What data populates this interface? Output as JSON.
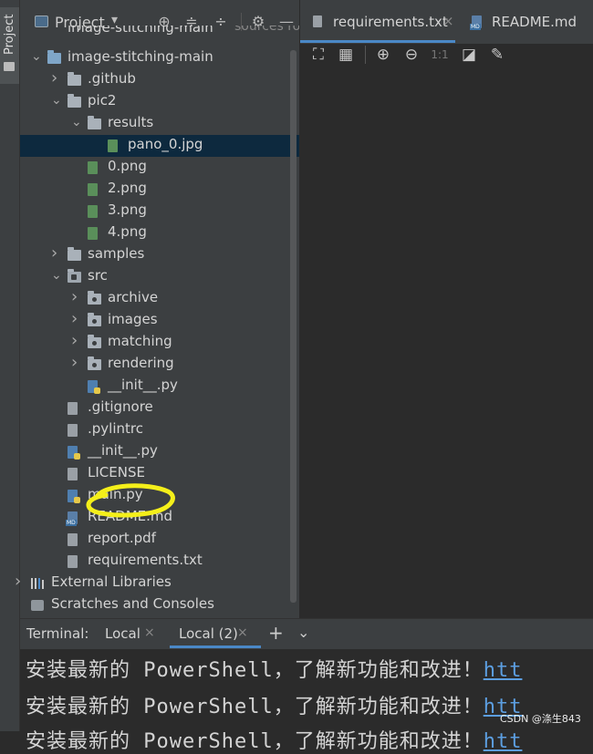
{
  "sidebar": {
    "tool_window_label": "Project"
  },
  "project_panel": {
    "view_label": "Project",
    "root_truncated": "image-stitching-main",
    "root_truncated_suffix": "sources root,",
    "tree": [
      {
        "label": "image-stitching-main",
        "type": "folder",
        "expanded": true
      },
      {
        "label": ".github",
        "type": "folder",
        "expanded": false
      },
      {
        "label": "pic2",
        "type": "folder",
        "expanded": true
      },
      {
        "label": "results",
        "type": "folder",
        "expanded": true
      },
      {
        "label": "pano_0.jpg",
        "type": "image",
        "selected": true
      },
      {
        "label": "0.png",
        "type": "image"
      },
      {
        "label": "2.png",
        "type": "image"
      },
      {
        "label": "3.png",
        "type": "image"
      },
      {
        "label": "4.png",
        "type": "image"
      },
      {
        "label": "samples",
        "type": "folder",
        "expanded": false
      },
      {
        "label": "src",
        "type": "folder",
        "expanded": true
      },
      {
        "label": "archive",
        "type": "package",
        "expanded": false
      },
      {
        "label": "images",
        "type": "package",
        "expanded": false
      },
      {
        "label": "matching",
        "type": "package",
        "expanded": false
      },
      {
        "label": "rendering",
        "type": "package",
        "expanded": false
      },
      {
        "label": "__init__.py",
        "type": "python"
      },
      {
        "label": ".gitignore",
        "type": "text"
      },
      {
        "label": ".pylintrc",
        "type": "text"
      },
      {
        "label": "__init__.py",
        "type": "python"
      },
      {
        "label": "LICENSE",
        "type": "text"
      },
      {
        "label": "main.py",
        "type": "python"
      },
      {
        "label": "README.md",
        "type": "markdown"
      },
      {
        "label": "report.pdf",
        "type": "pdf"
      },
      {
        "label": "requirements.txt",
        "type": "text"
      },
      {
        "label": "External Libraries",
        "type": "libraries",
        "expanded": false
      },
      {
        "label": "Scratches and Consoles",
        "type": "scratches"
      }
    ]
  },
  "editor": {
    "tabs": [
      {
        "label": "requirements.txt",
        "active": true
      },
      {
        "label": "README.md",
        "active": false
      }
    ],
    "image_tools": [
      "fit-icon",
      "grid-icon",
      "zoom-in-icon",
      "zoom-out-icon",
      "actual-size-icon",
      "background-icon",
      "color-picker-icon"
    ],
    "actual_size_label": "1:1"
  },
  "terminal": {
    "title": "Terminal:",
    "tabs": [
      {
        "label": "Local",
        "active": false
      },
      {
        "label": "Local (2)",
        "active": true
      }
    ],
    "lines": [
      {
        "text": "安装最新的 PowerShell，了解新功能和改进！",
        "link": "htt"
      },
      {
        "text": "安装最新的 PowerShell，了解新功能和改进！",
        "link": "htt"
      },
      {
        "text": "安装最新的 PowerShell，了解新功能和改进！",
        "link": "htt"
      }
    ]
  },
  "watermark": "CSDN @涤生843",
  "colors": {
    "selection": "#0d293e",
    "accent": "#4a88c7",
    "annotation": "#f4ef1a",
    "link": "#5c9ee0"
  }
}
